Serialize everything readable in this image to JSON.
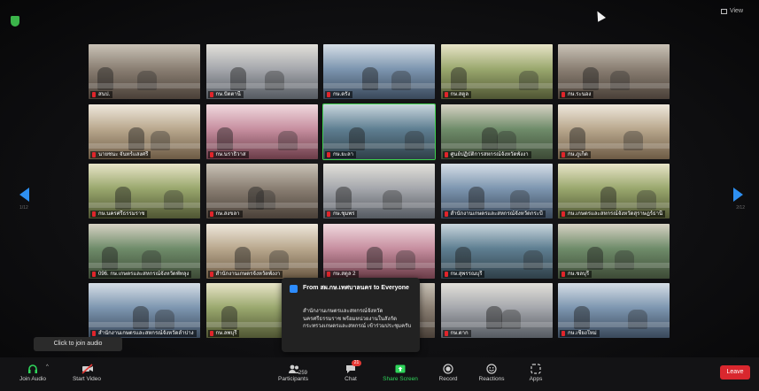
{
  "top": {
    "view_label": "View"
  },
  "nav": {
    "prev_page": "1/12",
    "next_page": "2/12"
  },
  "tiles": [
    [
      "สนป.",
      "กษ.ปัตตานี",
      "กษ.ตรัง",
      "กษ.สตูล",
      "กษ.ระนอง"
    ],
    [
      "นายชนะ จันทร์แสงศรี",
      "กษ.นราธิวาส",
      "กษ.ยะลา",
      "ศูนย์ปฏิบัติการสหกรณ์จังหวัดพังงา",
      "กษ.ภูเก็ต"
    ],
    [
      "กษ.นครศรีธรรมราช",
      "กษ.สงขลา",
      "กษ.ชุมพร",
      "สำนักงานเกษตรและสหกรณ์จังหวัดกระบี่",
      "กษ.เกษตรและสหกรณ์จังหวัดสุราษฎร์ธานี"
    ],
    [
      "096. กษ.เกษตรและสหกรณ์จังหวัดพัทลุง",
      "สำนักงานเกษตรจังหวัดพังงา",
      "กษ.สตูล 2",
      "กษ.สุพรรณบุรี",
      "กษ.ชลบุรี"
    ],
    [
      "สำนักงานเกษตรและสหกรณ์จังหวัดลำปาง",
      "กษ.ลพบุรี",
      "",
      "กษ.ตาก",
      "กษ.เชียงใหม่"
    ]
  ],
  "toast": {
    "from": "From สผ.กษ.เทศบาลนคร to Everyone",
    "message": "สำนักงานเกษตรและสหกรณ์จังหวัด นครศรีธรรมราช พร้อมหน่วยงานในสังกัดกระทรวงเกษตรและสหกรณ์ เข้าร่วมประชุมครับ"
  },
  "join_tip": "Click to join audio",
  "toolbar": {
    "join_audio": "Join Audio",
    "start_video": "Start Video",
    "participants": "Participants",
    "participants_count": "259",
    "chat": "Chat",
    "chat_badge": "21",
    "share_screen": "Share Screen",
    "record": "Record",
    "reactions": "Reactions",
    "apps": "Apps",
    "leave": "Leave"
  }
}
